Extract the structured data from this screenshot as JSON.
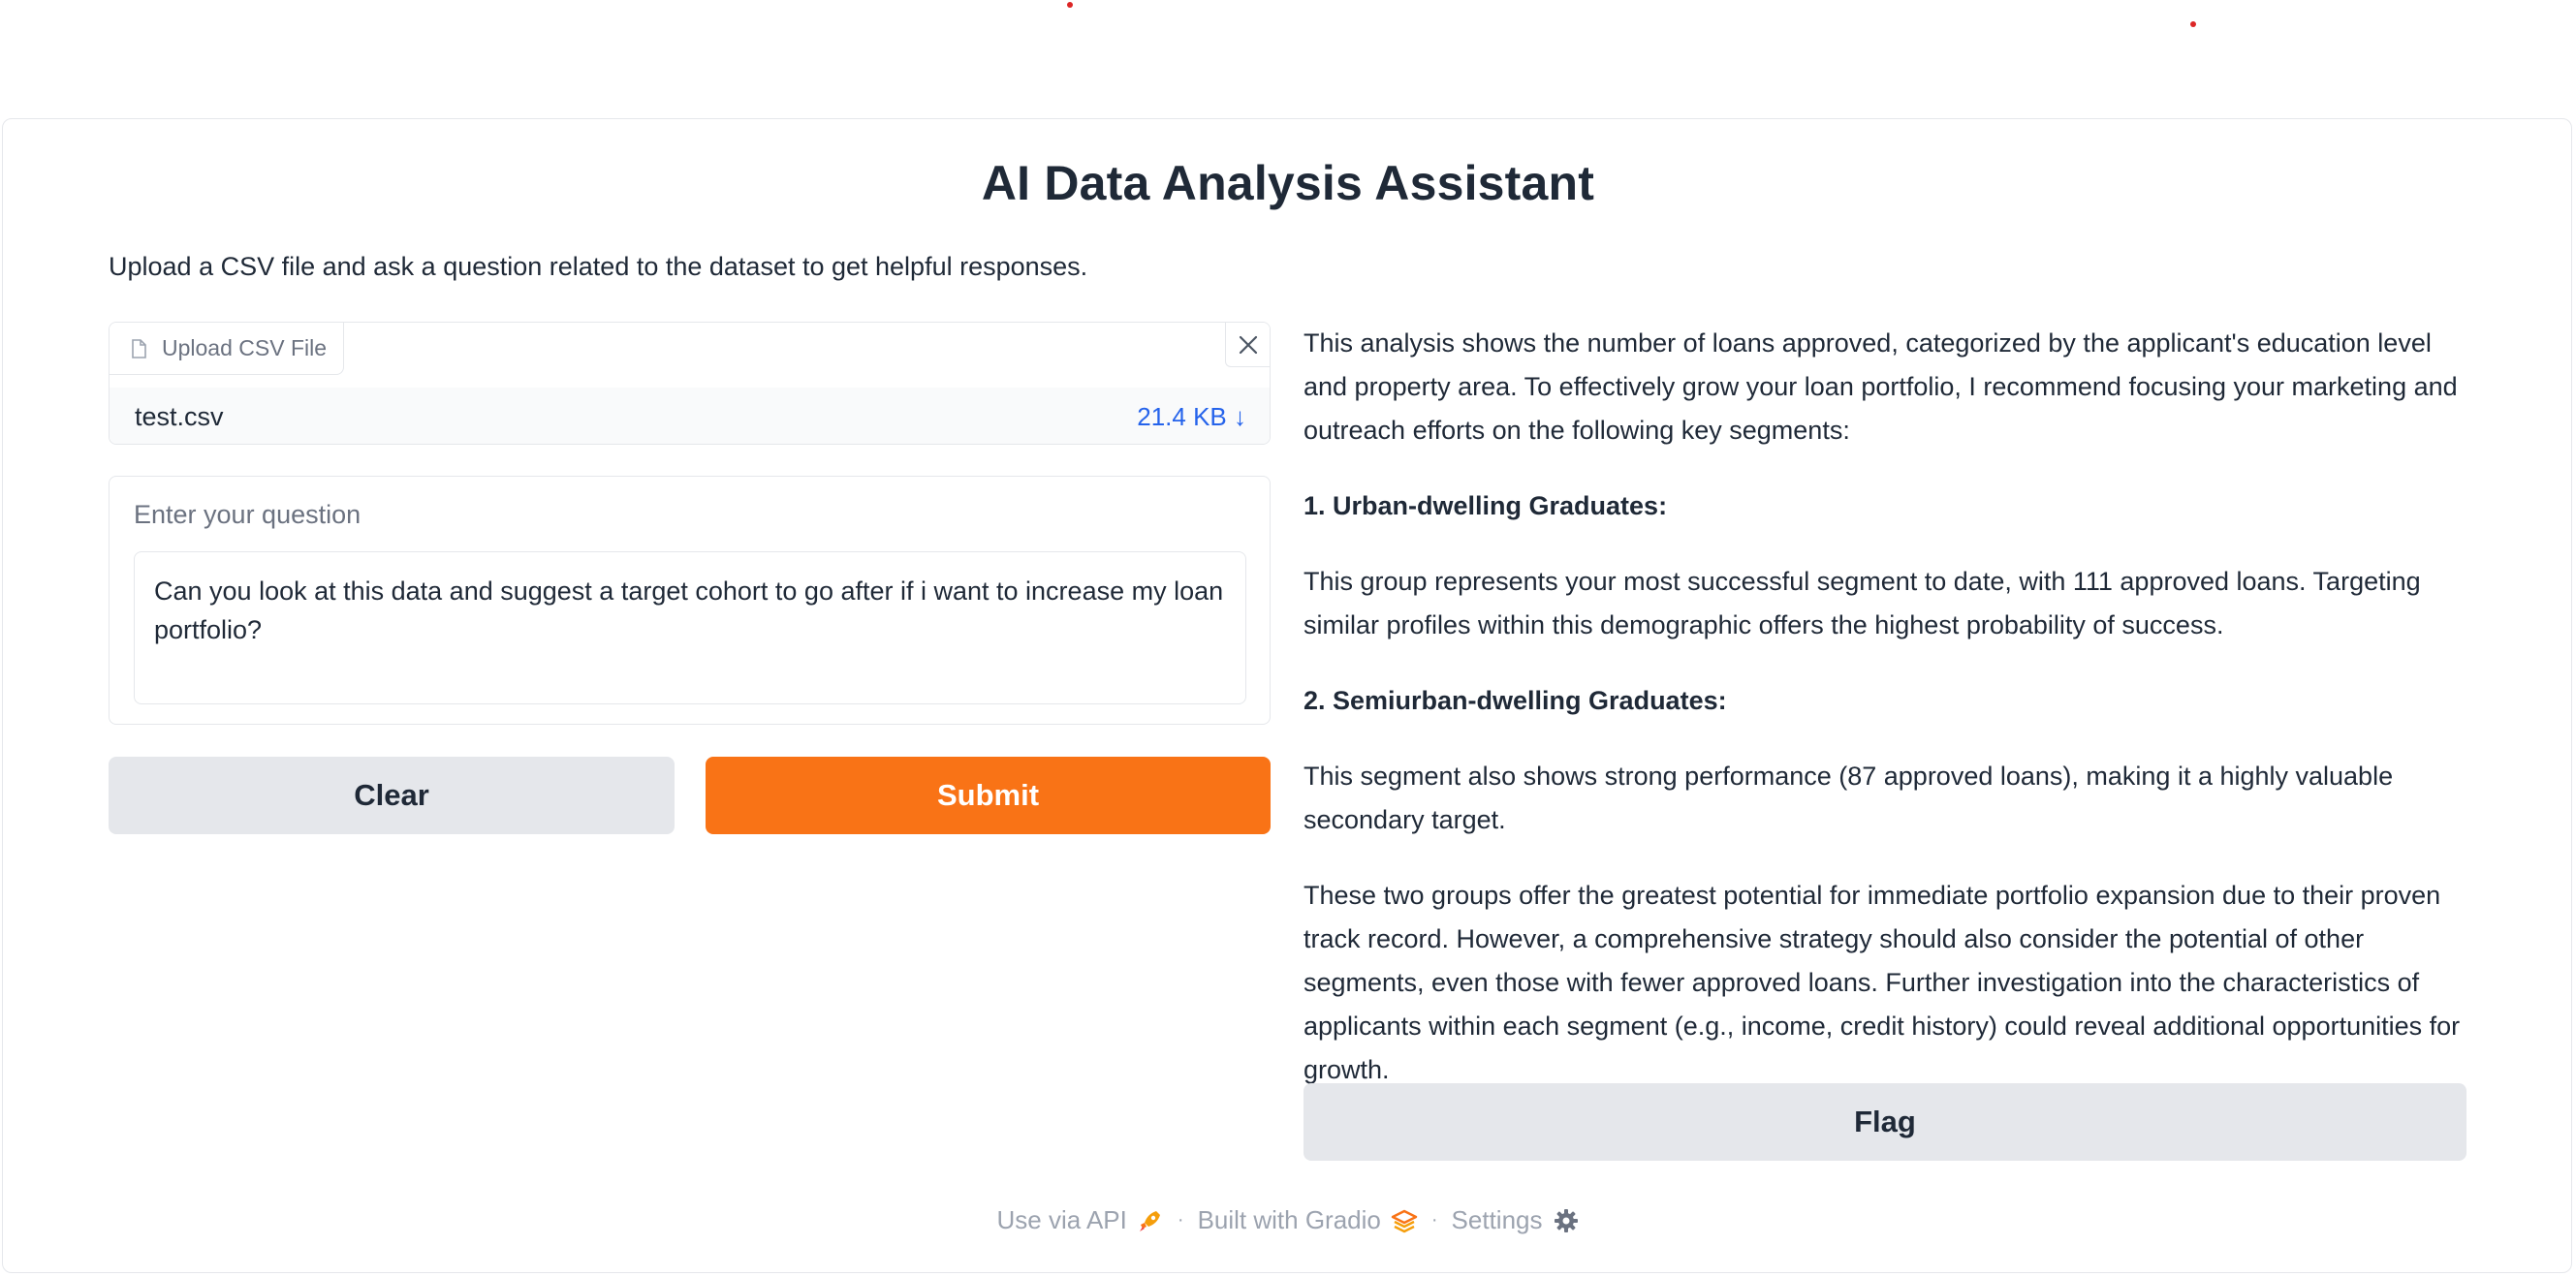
{
  "header": {
    "title": "AI Data Analysis Assistant",
    "description": "Upload a CSV file and ask a question related to the dataset to get helpful responses."
  },
  "upload": {
    "label": "Upload CSV File",
    "file_name": "test.csv",
    "file_size": "21.4 KB ↓",
    "file_icon": "file-icon",
    "clear_icon": "close-icon"
  },
  "question": {
    "label": "Enter your question",
    "value": "Can you look at this data and suggest a target cohort to go after if i want to increase my loan portfolio?"
  },
  "buttons": {
    "clear": "Clear",
    "submit": "Submit",
    "flag": "Flag"
  },
  "output": {
    "intro": "This analysis shows the number of loans approved, categorized by the applicant's education level and property area. To effectively grow your loan portfolio, I recommend focusing your marketing and outreach efforts on the following key segments:",
    "heading1": "1. Urban-dwelling Graduates:",
    "para1": "This group represents your most successful segment to date, with 111 approved loans. Targeting similar profiles within this demographic offers the highest probability of success.",
    "heading2": "2. Semiurban-dwelling Graduates:",
    "para2": "This segment also shows strong performance (87 approved loans), making it a highly valuable secondary target.",
    "conclusion": "These two groups offer the greatest potential for immediate portfolio expansion due to their proven track record. However, a comprehensive strategy should also consider the potential of other segments, even those with fewer approved loans. Further investigation into the characteristics of applicants within each segment (e.g., income, credit history) could reveal additional opportunities for growth."
  },
  "footer": {
    "api_label": "Use via API",
    "api_icon": "rocket-icon",
    "built_label": "Built with Gradio",
    "gradio_icon": "gradio-logo-icon",
    "settings_label": "Settings",
    "settings_icon": "gear-icon",
    "separator": "·"
  },
  "colors": {
    "accent": "#f97316",
    "secondary_button": "#e5e7eb",
    "link": "#2563eb"
  }
}
